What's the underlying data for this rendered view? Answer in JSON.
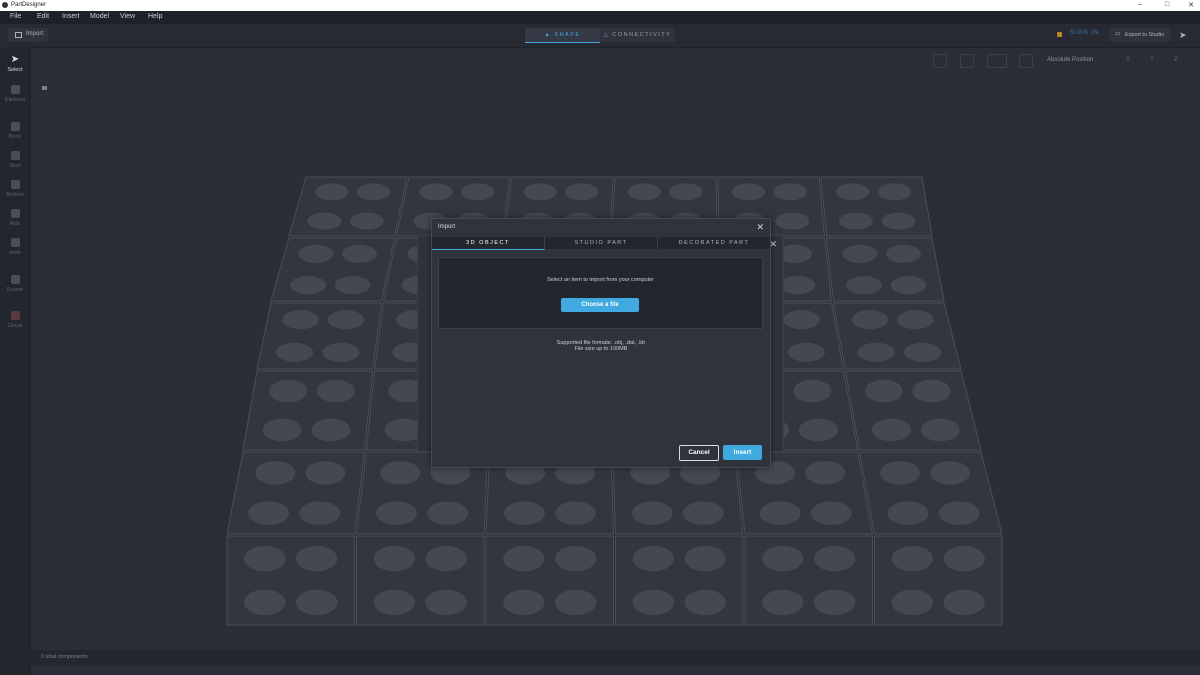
{
  "app": {
    "title": "PartDesigner"
  },
  "menu": [
    "File",
    "Edit",
    "Insert",
    "Model",
    "View",
    "Help"
  ],
  "toolbar": {
    "import_label": "Import",
    "modes": [
      "SHAPE",
      "CONNECTIVITY"
    ],
    "active_mode": "SHAPE",
    "sign_in_label": "SIGN IN",
    "export_label": "Export to Studio"
  },
  "sidebar": {
    "tools": [
      "Select",
      "Element",
      "Brick",
      "Stud",
      "Bottom",
      "Axle",
      "Hole",
      "Eraser",
      "Decal"
    ],
    "active_tool": "Select"
  },
  "subbar": {
    "position_label": "Absolute Position",
    "axes": [
      "X",
      "Y",
      "Z"
    ]
  },
  "statusbar": {
    "text": "0 total components"
  },
  "dialog": {
    "title": "Import",
    "tabs": [
      "3D OBJECT",
      "STUDIO PART",
      "DECORATED PART"
    ],
    "active_tab": "3D OBJECT",
    "prompt": "Select an item to import from your computer",
    "choose_label": "Choose a file",
    "supported": "Supported file formats: .obj, .dat, .ldr",
    "size_limit": "File size up to 100MB",
    "cancel_label": "Cancel",
    "insert_label": "Insert"
  },
  "colors": {
    "accent": "#3fa9e0",
    "background": "#2b2e38",
    "plate": "#333640",
    "stud": "#444853"
  }
}
